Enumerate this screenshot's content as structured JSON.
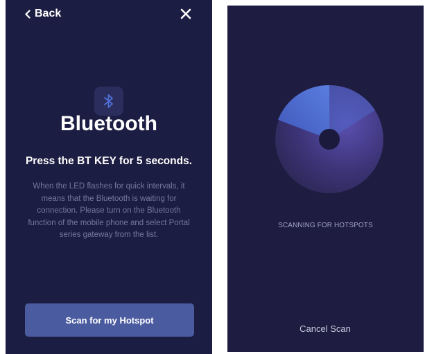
{
  "left_screen": {
    "nav": {
      "back_label": "Back"
    },
    "icons": {
      "back": "chevron-left-icon",
      "close": "close-icon",
      "bluetooth": "bluetooth-icon"
    },
    "title": "Bluetooth",
    "instruction_heading": "Press the BT KEY for 5 seconds.",
    "instruction_body": "When the LED flashes for quick intervals, it means that the Bluetooth is waiting for connection. Please turn on the Bluetooth function of the mobile phone and select Portal series gateway from the list.",
    "scan_button_label": "Scan for my Hotspot"
  },
  "right_screen": {
    "status_text": "SCANNING FOR HOTSPOTS",
    "cancel_label": "Cancel Scan"
  },
  "colors": {
    "background": "#1c1d42",
    "accent_button": "#4a5b9f",
    "radar_light": "#4c6fd0",
    "radar_dark": "#2a2550",
    "muted_text": "#73779f"
  }
}
